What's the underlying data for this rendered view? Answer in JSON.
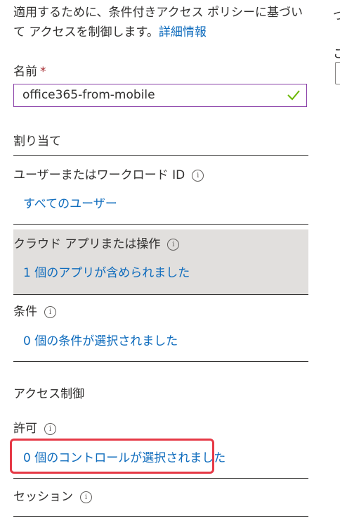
{
  "intro": {
    "text": "適用するために、条件付きアクセス ポリシーに基づいて アクセスを制御します。",
    "link": "詳細情報"
  },
  "name_field": {
    "label": "名前",
    "required_mark": "*",
    "value": "office365-from-mobile"
  },
  "assignments": {
    "title": "割り当て",
    "users": {
      "label": "ユーザーまたはワークロード ID",
      "value": "すべてのユーザー"
    },
    "cloud_apps": {
      "label": "クラウド アプリまたは操作",
      "value": "1 個のアプリが含められました"
    },
    "conditions": {
      "label": "条件",
      "value": "0 個の条件が選択されました"
    }
  },
  "access_controls": {
    "title": "アクセス制御",
    "grant": {
      "label": "許可",
      "value": "0 個のコントロールが選択されました"
    },
    "session": {
      "label": "セッション"
    }
  },
  "info_glyph": "i",
  "right_panel": {
    "fragment_top": "つ",
    "fragment_mid": "こ"
  },
  "colors": {
    "link": "#0f6cbd",
    "required": "#a4262c",
    "input_border": "#8a3fa8",
    "valid_check": "#6bb700",
    "highlight": "#e63946",
    "shaded_row": "#e1dfdd"
  }
}
